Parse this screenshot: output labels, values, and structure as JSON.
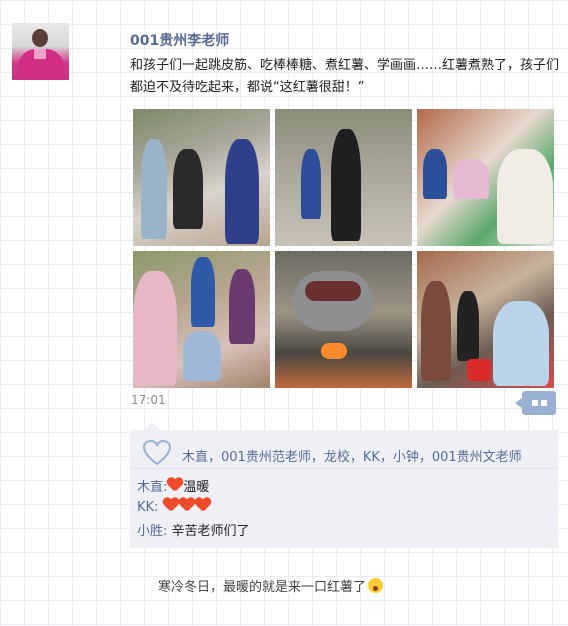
{
  "post": {
    "author": "001贵州李老师",
    "text": "和孩子们一起跳皮筋、吃棒棒糖、煮红薯、学画画……红薯煮熟了，孩子们都迫不及待吃起来，都说“这红薯很甜！”",
    "time": "17:01",
    "photo_count": 6
  },
  "likes": {
    "names": "木直，001贵州范老师，龙校，KK，小钟，001贵州文老师"
  },
  "comments": [
    {
      "user": "木直:",
      "text": "温暖",
      "hearts": 1
    },
    {
      "user": "KK:",
      "text": "",
      "hearts": 3
    },
    {
      "user": "小胜:",
      "text": "辛苦老师们了",
      "hearts": 0
    }
  ],
  "footer": {
    "text": "寒冷冬日，最暖的就是来一口红薯了"
  },
  "colors": {
    "link": "#576b95",
    "panel": "#eef0f5",
    "heart": "#ef4b2b",
    "action_button": "#9ab0d2"
  },
  "icons": {
    "like": "heart-outline-icon",
    "more": "more-actions-icon",
    "comment_heart": "red-heart-icon",
    "footer_emoji": "surprised-face-icon"
  }
}
